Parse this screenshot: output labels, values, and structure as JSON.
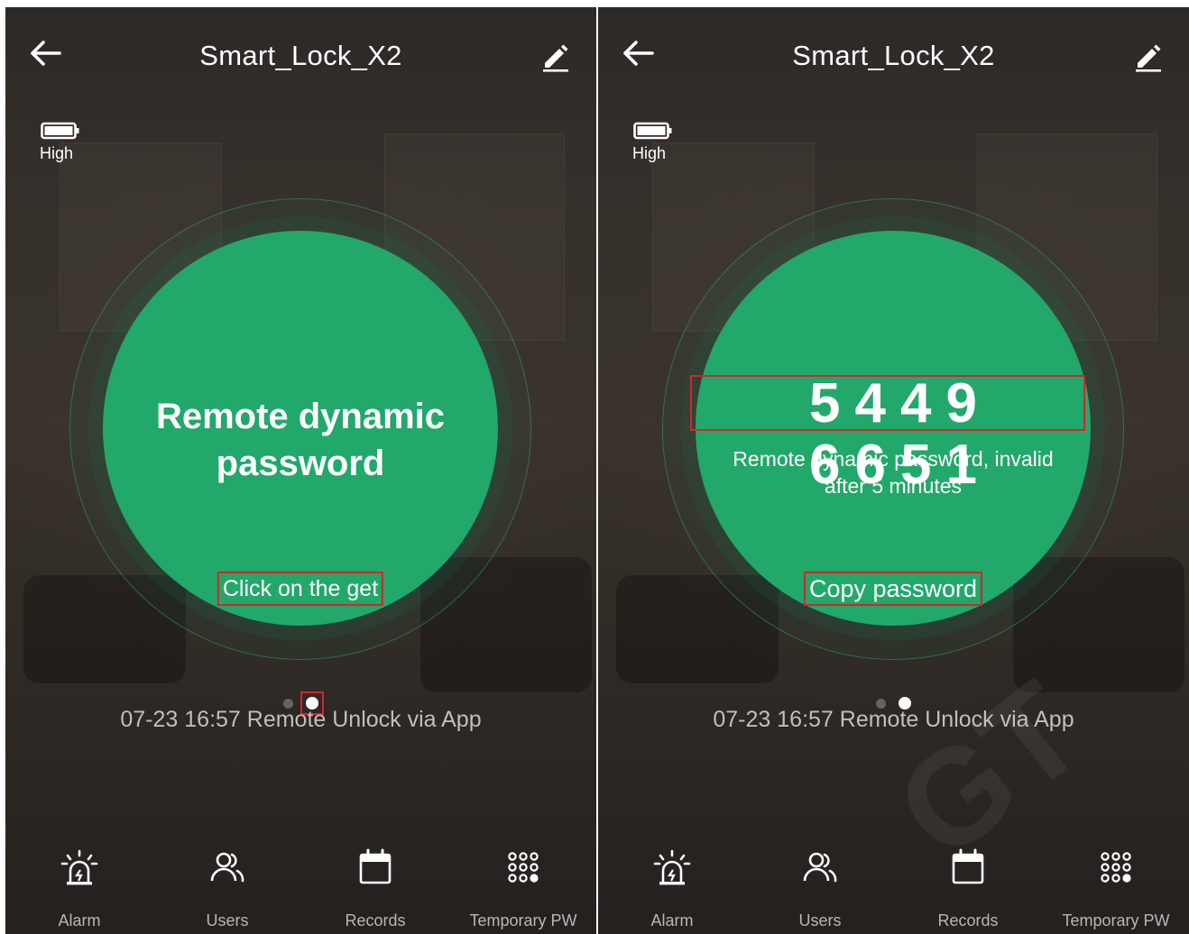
{
  "screens": [
    {
      "title": "Smart_Lock_X2",
      "battery_label": "High",
      "circle_title": "Remote dynamic password",
      "action_label": "Click on the get",
      "record": "07-23 16:57  Remote Unlock via App",
      "pager_active_index": 1
    },
    {
      "title": "Smart_Lock_X2",
      "battery_label": "High",
      "password": "5449 6651",
      "password_note": "Remote dynamic password, invalid after 5 minutes",
      "action_label": "Copy password",
      "record": "07-23 16:57  Remote Unlock via App",
      "pager_active_index": 1
    }
  ],
  "nav_items": [
    {
      "label": "Alarm",
      "icon": "alarm-icon"
    },
    {
      "label": "Users",
      "icon": "users-icon"
    },
    {
      "label": "Records",
      "icon": "records-icon"
    },
    {
      "label": "Temporary PW",
      "icon": "grid-dots-icon"
    }
  ],
  "colors": {
    "accent_green": "#22a86a",
    "highlight_red": "#d2262c",
    "text_white": "#ffffff",
    "text_gray": "#b7b7b7"
  }
}
